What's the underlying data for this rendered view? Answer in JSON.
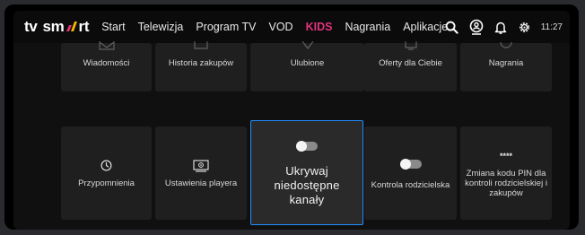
{
  "header": {
    "logo_tv": "tv",
    "logo_sm": "sm",
    "logo_rt": "rt",
    "nav": [
      {
        "label": "Start"
      },
      {
        "label": "Telewizja"
      },
      {
        "label": "Program TV"
      },
      {
        "label": "VOD"
      },
      {
        "label": "KIDS"
      },
      {
        "label": "Nagrania"
      },
      {
        "label": "Aplikacje"
      }
    ],
    "icons": [
      "search-icon",
      "profile-icon",
      "bell-icon",
      "gear-icon"
    ],
    "time": "11:27"
  },
  "tiles_row1": [
    {
      "label": "Wiadomości",
      "icon": "envelope-icon"
    },
    {
      "label": "Historia zakupów",
      "icon": "monitor-icon"
    },
    {
      "label": "Ulubione",
      "icon": "heart-icon"
    },
    {
      "label": "Oferty dla Ciebie",
      "icon": "tv-icon"
    },
    {
      "label": "Nagrania",
      "icon": "record-icon"
    }
  ],
  "tiles_row2": [
    {
      "label": "Przypomnienia",
      "icon": "clock-icon"
    },
    {
      "label": "Ustawienia playera",
      "icon": "player-settings-icon"
    },
    {
      "label": "Ukrywaj niedostępne kanały",
      "icon": "toggle-switch",
      "toggle": "off",
      "focused": true
    },
    {
      "label": "Kontrola rodzicielska",
      "icon": "toggle-switch",
      "toggle": "off"
    },
    {
      "label": "Zmiana kodu PIN dla kontroli rodzicielskiej i zakupów",
      "icon": "pin-dots-icon",
      "pin_mask": "****"
    }
  ],
  "colors": {
    "kids": "#e0337a",
    "focus_border": "#1e8fff",
    "logo_slash_top": "#e0337a",
    "logo_slash_bottom": "#f5b400"
  }
}
